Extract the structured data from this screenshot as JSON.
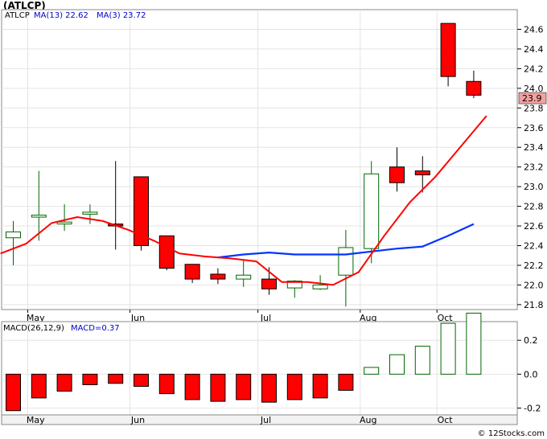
{
  "chart_data": [
    {
      "type": "candlestick",
      "title": "(ATLCP)",
      "legend": [
        {
          "label": "ATLCP",
          "color": "#000000"
        },
        {
          "label": "MA(13)",
          "value": "22.62",
          "color": "#0000cc"
        },
        {
          "label": "MA(3)",
          "value": "23.72",
          "color": "#0000cc"
        }
      ],
      "last_price_label": "23.9",
      "ylim": [
        21.75,
        24.8
      ],
      "y_ticks": [
        "21.8",
        "22.0",
        "22.2",
        "22.4",
        "22.6",
        "22.8",
        "23.0",
        "23.2",
        "23.4",
        "23.6",
        "23.8",
        "24.0",
        "24.2",
        "24.4",
        "24.6"
      ],
      "x_labels": [
        {
          "label": "May",
          "i": 1
        },
        {
          "label": "Jun",
          "i": 5
        },
        {
          "label": "Jul",
          "i": 10
        },
        {
          "label": "Aug",
          "i": 14
        },
        {
          "label": "Oct",
          "i": 17
        }
      ],
      "candles": [
        {
          "open": 22.48,
          "high": 22.65,
          "low": 22.2,
          "close": 22.54
        },
        {
          "open": 22.69,
          "high": 23.16,
          "low": 22.45,
          "close": 22.71
        },
        {
          "open": 22.62,
          "high": 22.82,
          "low": 22.55,
          "close": 22.64
        },
        {
          "open": 22.72,
          "high": 22.82,
          "low": 22.62,
          "close": 22.74
        },
        {
          "open": 22.62,
          "high": 23.26,
          "low": 22.36,
          "close": 22.6
        },
        {
          "open": 23.1,
          "high": 23.1,
          "low": 22.35,
          "close": 22.4
        },
        {
          "open": 22.5,
          "high": 22.5,
          "low": 22.15,
          "close": 22.17
        },
        {
          "open": 22.21,
          "high": 22.21,
          "low": 22.02,
          "close": 22.06
        },
        {
          "open": 22.11,
          "high": 22.17,
          "low": 22.01,
          "close": 22.06
        },
        {
          "open": 22.06,
          "high": 22.25,
          "low": 21.98,
          "close": 22.1
        },
        {
          "open": 22.06,
          "high": 22.18,
          "low": 21.9,
          "close": 21.96
        },
        {
          "open": 21.97,
          "high": 22.05,
          "low": 21.87,
          "close": 22.04
        },
        {
          "open": 21.96,
          "high": 22.1,
          "low": 21.95,
          "close": 22.0
        },
        {
          "open": 22.1,
          "high": 22.56,
          "low": 21.78,
          "close": 22.38
        },
        {
          "open": 22.37,
          "high": 23.26,
          "low": 22.22,
          "close": 23.13
        },
        {
          "open": 23.2,
          "high": 23.4,
          "low": 22.95,
          "close": 23.04
        },
        {
          "open": 23.16,
          "high": 23.31,
          "low": 22.94,
          "close": 23.12
        },
        {
          "open": 24.66,
          "high": 24.66,
          "low": 24.02,
          "close": 24.12
        },
        {
          "open": 24.07,
          "high": 24.18,
          "low": 23.9,
          "close": 23.93
        }
      ],
      "ma13": [
        null,
        null,
        null,
        null,
        null,
        null,
        null,
        null,
        22.28,
        22.31,
        22.33,
        22.31,
        22.31,
        22.31,
        22.34,
        22.37,
        22.39,
        22.5,
        22.62
      ],
      "ma3": [
        22.32,
        22.42,
        22.63,
        22.69,
        22.65,
        22.56,
        22.45,
        22.32,
        22.29,
        22.27,
        22.24,
        22.03,
        22.03,
        22.0,
        22.13,
        22.5,
        22.84,
        23.1,
        23.41,
        23.72
      ]
    },
    {
      "type": "bar",
      "legend": [
        {
          "label": "MACD(26,12,9)",
          "color": "#000000"
        },
        {
          "label": "MACD=0.37",
          "color": "#0000cc"
        }
      ],
      "ylim": [
        -0.24,
        0.31
      ],
      "y_ticks": [
        "0.2",
        "0.0",
        "-0.2"
      ],
      "x_labels": [
        {
          "label": "May",
          "i": 1
        },
        {
          "label": "Jun",
          "i": 5
        },
        {
          "label": "Jul",
          "i": 10
        },
        {
          "label": "Aug",
          "i": 14
        },
        {
          "label": "Oct",
          "i": 17
        }
      ],
      "values": [
        -0.215,
        -0.14,
        -0.1,
        -0.062,
        -0.054,
        -0.072,
        -0.115,
        -0.15,
        -0.16,
        -0.15,
        -0.165,
        -0.15,
        -0.14,
        -0.095,
        0.04,
        0.115,
        0.165,
        0.3,
        0.36
      ]
    }
  ],
  "footer": "© 12Stocks.com"
}
